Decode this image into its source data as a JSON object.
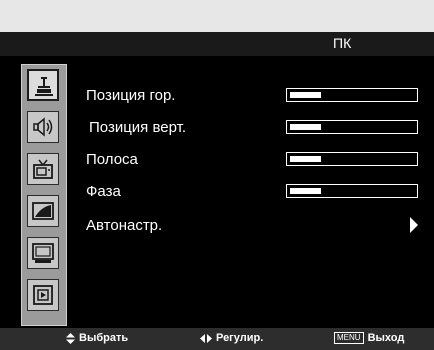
{
  "title": "ПК",
  "sidebar": {
    "icons": [
      {
        "name": "picture-icon",
        "selected": true
      },
      {
        "name": "audio-icon",
        "selected": false
      },
      {
        "name": "tv-icon",
        "selected": false
      },
      {
        "name": "curve-icon",
        "selected": false
      },
      {
        "name": "screen-icon",
        "selected": false
      },
      {
        "name": "input-icon",
        "selected": false
      }
    ]
  },
  "menu": {
    "items": [
      {
        "label": "Позиция гор.",
        "control": "slider",
        "level": 0.25
      },
      {
        "label": "Позиция верт.",
        "control": "slider",
        "level": 0.25
      },
      {
        "label": "Полоса",
        "control": "slider",
        "level": 0.25
      },
      {
        "label": "Фаза",
        "control": "slider",
        "level": 0.25
      },
      {
        "label": "Автонастр.",
        "control": "submenu",
        "level": null
      }
    ]
  },
  "footer": {
    "select_label": "Выбрать",
    "adjust_label": "Регулир.",
    "menu_badge": "MENU",
    "exit_label": "Выход"
  },
  "colors": {
    "background": "#000000",
    "text": "#ffffff",
    "sidebar": "#9b9b9b"
  }
}
